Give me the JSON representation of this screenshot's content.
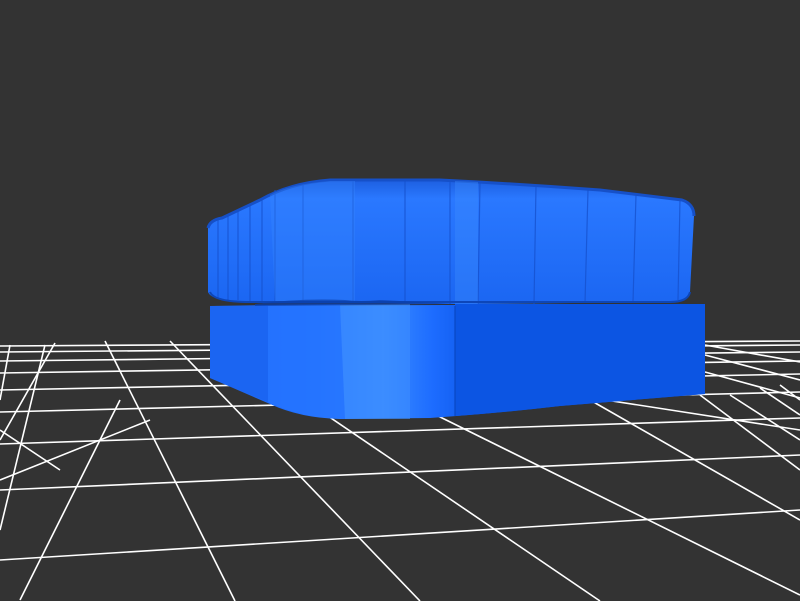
{
  "scene": {
    "background_color": "#333333",
    "grid_color": "#ffffff",
    "model_color": "#1f6fff",
    "model_shade_dark": "#0d4fd6",
    "model_shade_light": "#3b8cff",
    "grid_visible": true,
    "object_description_icon": "3d-model-icon"
  }
}
